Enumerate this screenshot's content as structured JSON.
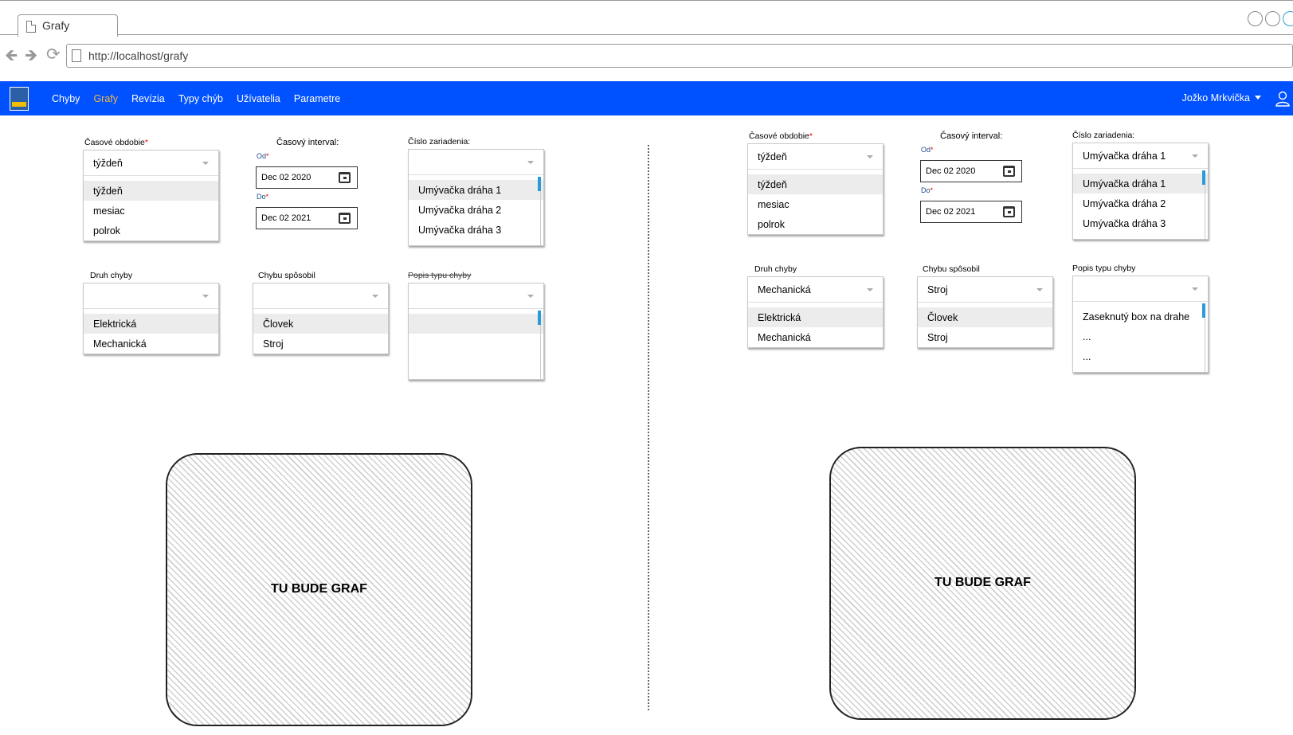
{
  "browser": {
    "tab_title": "Grafy",
    "url": "http://localhost/grafy"
  },
  "navbar": {
    "items": [
      "Chyby",
      "Grafy",
      "Revízia",
      "Typy chýb",
      "Užívatelia",
      "Parametre"
    ],
    "active": "Grafy",
    "user": "Jožko Mrkvička",
    "accent_color": "#0051ff",
    "active_color": "#f4b942"
  },
  "left": {
    "period": {
      "label": "Časové obdobie",
      "required": "*",
      "value": "týždeň",
      "options": [
        "týždeň",
        "mesiac",
        "polrok"
      ],
      "selected": "týždeň"
    },
    "interval": {
      "label": "Časový interval:",
      "from_label": "Od",
      "from_value": "Dec 02 2020",
      "to_label": "Do",
      "to_value": "Dec 02 2021"
    },
    "device": {
      "label": "Číslo zariadenia:",
      "value": "",
      "options": [
        "Umývačka dráha 1",
        "Umývačka dráha 2",
        "Umývačka dráha 3"
      ],
      "selected": "Umývačka dráha 1"
    },
    "fault_type": {
      "label": "Druh chyby",
      "value": "",
      "options": [
        "Elektrická",
        "Mechanická"
      ],
      "selected": "Elektrická"
    },
    "caused_by": {
      "label": "Chybu spôsobil",
      "value": "",
      "options": [
        "Človek",
        "Stroj"
      ],
      "selected": "Človek"
    },
    "fault_desc": {
      "label": "Popis typu chyby",
      "value": "",
      "options": [
        ""
      ]
    },
    "graph_text": "TU BUDE GRAF"
  },
  "right": {
    "period": {
      "label": "Časové obdobie",
      "required": "*",
      "value": "týždeň",
      "options": [
        "týždeň",
        "mesiac",
        "polrok"
      ],
      "selected": "týždeň"
    },
    "interval": {
      "label": "Časový interval:",
      "from_label": "Od",
      "from_value": "Dec 02 2020",
      "to_label": "Do",
      "to_value": "Dec 02 2021"
    },
    "device": {
      "label": "Číslo zariadenia:",
      "value": "Umývačka dráha 1",
      "options": [
        "Umývačka dráha 1",
        "Umývačka dráha 2",
        "Umývačka dráha 3"
      ],
      "selected": "Umývačka dráha 1"
    },
    "fault_type": {
      "label": "Druh chyby",
      "value": "Mechanická",
      "options": [
        "Elektrická",
        "Mechanická"
      ],
      "selected": "Elektrická"
    },
    "caused_by": {
      "label": "Chybu spôsobil",
      "value": "Stroj",
      "options": [
        "Človek",
        "Stroj"
      ],
      "selected": "Človek"
    },
    "fault_desc": {
      "label": "Popis typu chyby",
      "value": "",
      "options": [
        "Zaseknutý box na drahe",
        "...",
        "..."
      ]
    },
    "graph_text": "TU BUDE GRAF"
  }
}
